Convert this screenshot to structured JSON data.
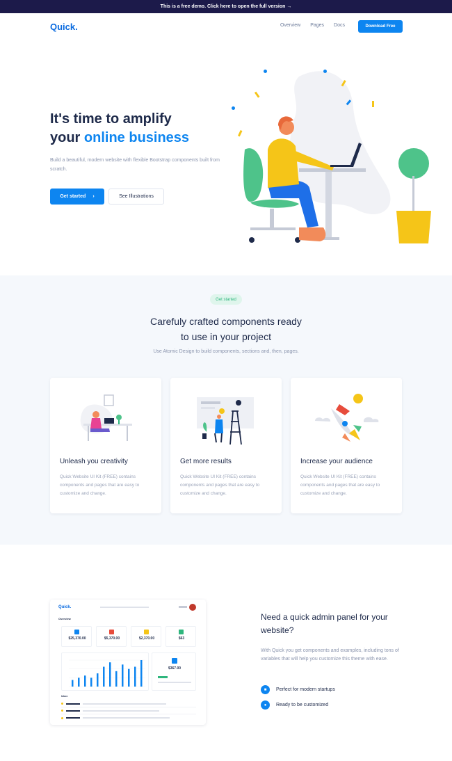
{
  "topbar": {
    "text": "This is a free demo. Click here to open the full version →"
  },
  "nav": {
    "logo": "Quick.",
    "links": [
      "Overview",
      "Pages",
      "Docs"
    ],
    "download": "Download Free"
  },
  "hero": {
    "title_line1": "It's time to amplify",
    "title_line2_plain": "your ",
    "title_line2_accent": "online business",
    "desc": "Build a beautiful, modern website with flexible Bootstrap components built from scratch.",
    "btn_start": "Get started",
    "btn_illustrations": "See Illustrations"
  },
  "features": {
    "badge": "Get started",
    "title_line1": "Carefuly crafted components ready",
    "title_line2": "to use in your project",
    "subtitle": "Use Atomic Design to build components, sections and, then, pages.",
    "cards": [
      {
        "title": "Unleash you creativity",
        "desc": "Quick Website UI Kit (FREE) contains components and pages that are easy to customize and change."
      },
      {
        "title": "Get more results",
        "desc": "Quick Website UI Kit (FREE) contains components and pages that are easy to customize and change."
      },
      {
        "title": "Increase your audience",
        "desc": "Quick Website UI Kit (FREE) contains components and pages that are easy to customize and change."
      }
    ]
  },
  "admin": {
    "title": "Need a quick admin panel for your website?",
    "desc": "With Quick you get components and examples, including tons of variables that will help you customize this theme with ease.",
    "features": [
      "Perfect for modern startups",
      "Ready to be customized"
    ],
    "mock": {
      "logo": "Quick.",
      "section": "Overview",
      "stats": [
        {
          "value": "$25,370.00",
          "color": "#0d85f0"
        },
        {
          "value": "$5,370.00",
          "color": "#e74c3c"
        },
        {
          "value": "$2,370.00",
          "color": "#f5c518"
        },
        {
          "value": "$63",
          "color": "#2eb67d"
        }
      ],
      "side_value": "$367.00",
      "inbox": "Inbox",
      "bars": [
        3,
        4,
        5,
        4,
        6,
        9,
        11,
        7,
        10,
        8,
        9,
        12
      ]
    }
  },
  "colors": {
    "primary": "#0d85f0",
    "dark": "#1e2a4a",
    "green": "#2eb67d",
    "yellow": "#f5c518"
  }
}
